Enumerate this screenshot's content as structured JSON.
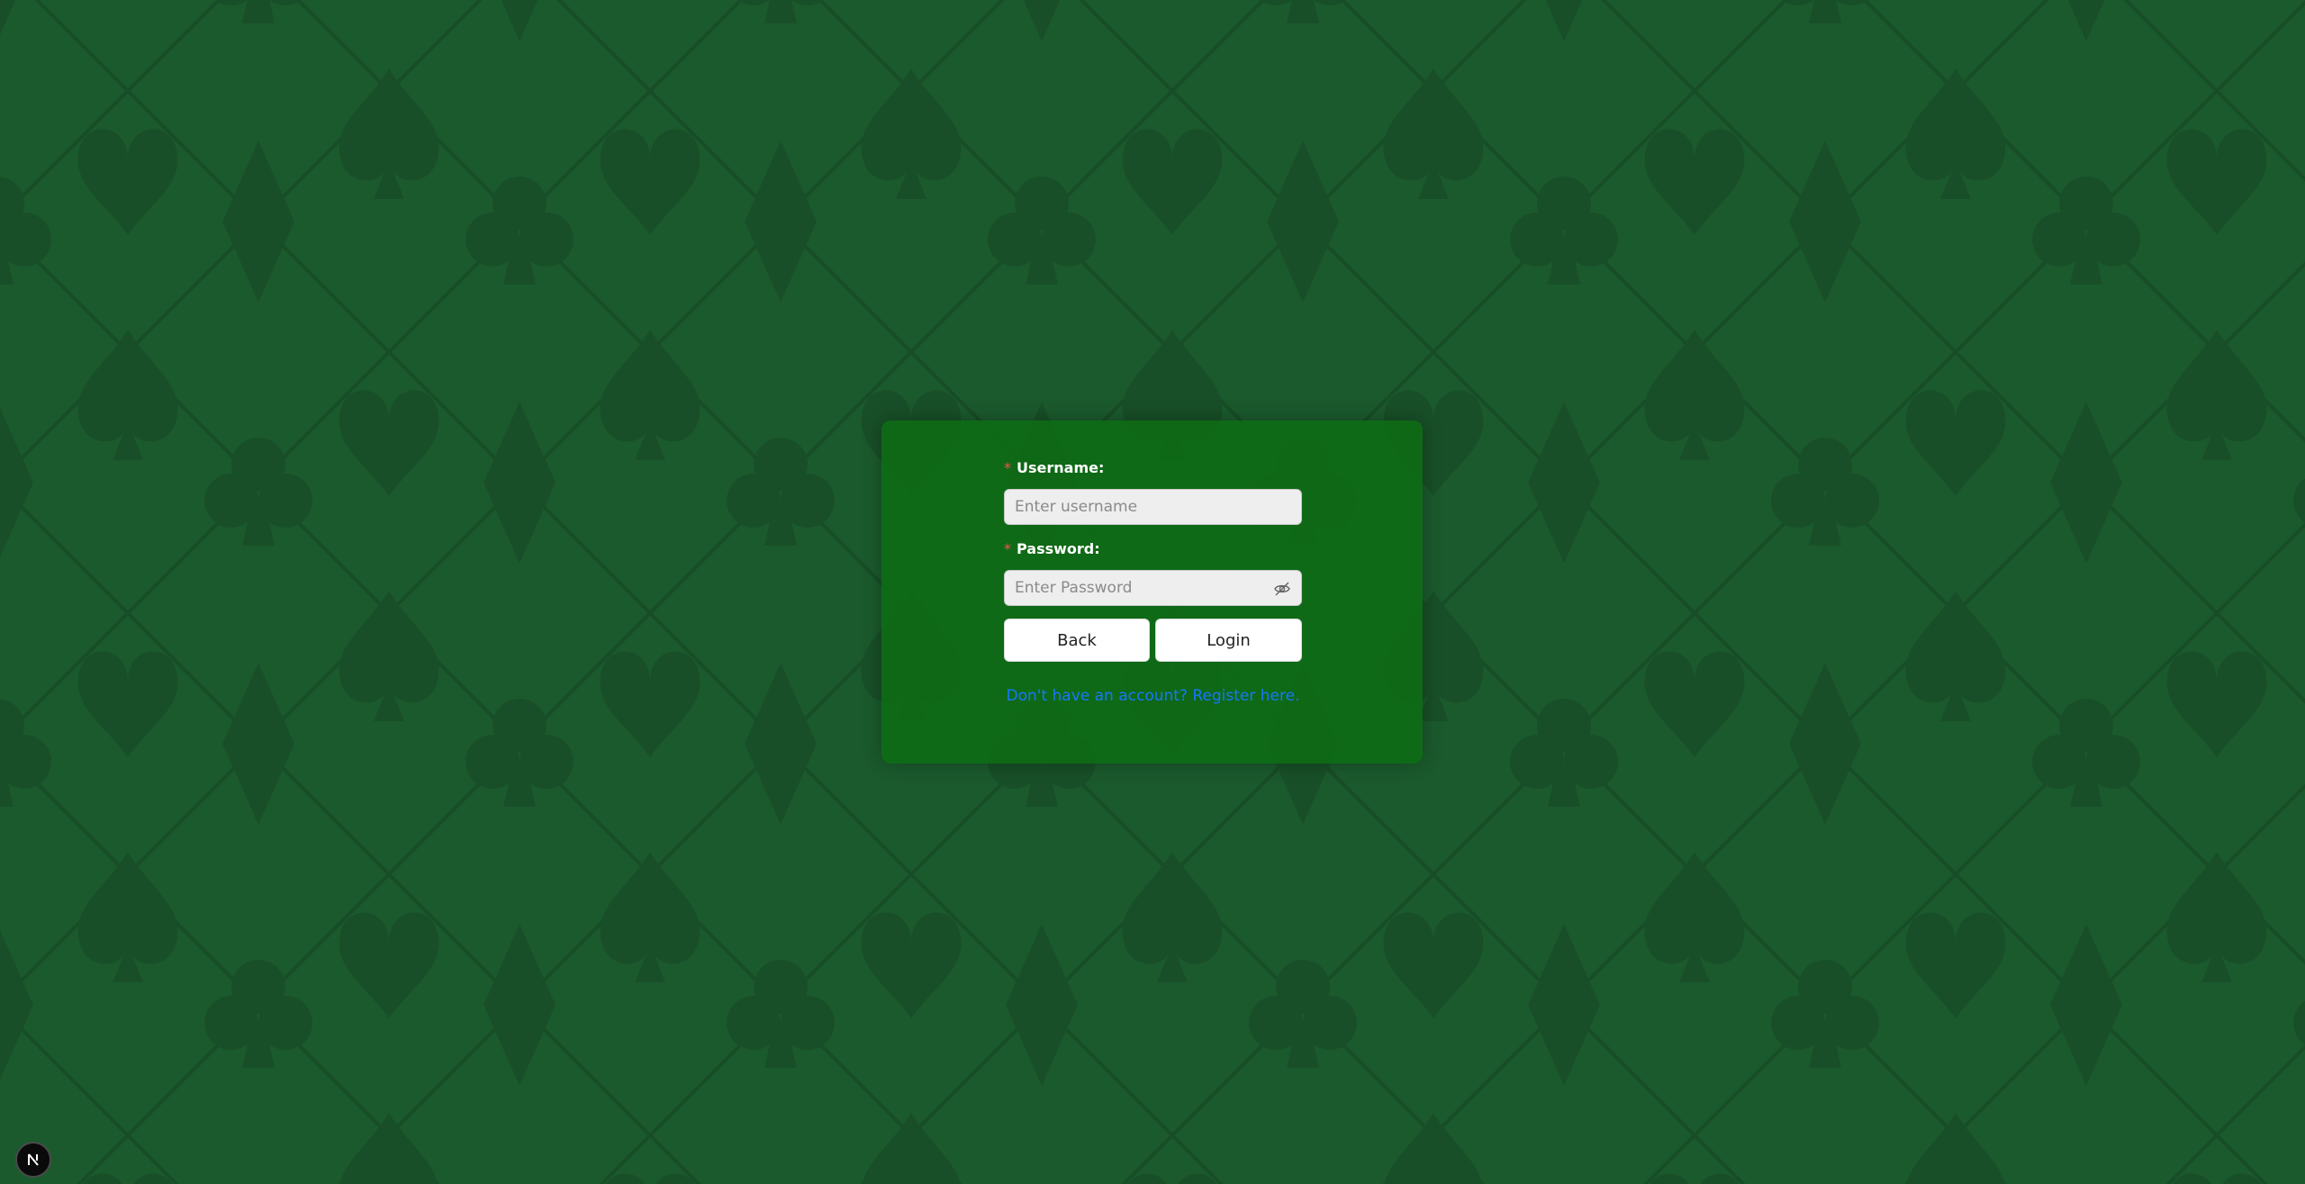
{
  "login": {
    "username_label": "Username:",
    "username_placeholder": "Enter username",
    "password_label": "Password:",
    "password_placeholder": "Enter Password",
    "back_label": "Back",
    "login_label": "Login",
    "register_text": "Don't have an account? Register here."
  },
  "colors": {
    "background": "#1b5a2d",
    "card": "#0e6e12",
    "link": "#1677ff",
    "required_mark": "#ff4d4f"
  },
  "icons": {
    "password_toggle": "eye-off-icon",
    "dev_badge": "nextjs-icon"
  }
}
